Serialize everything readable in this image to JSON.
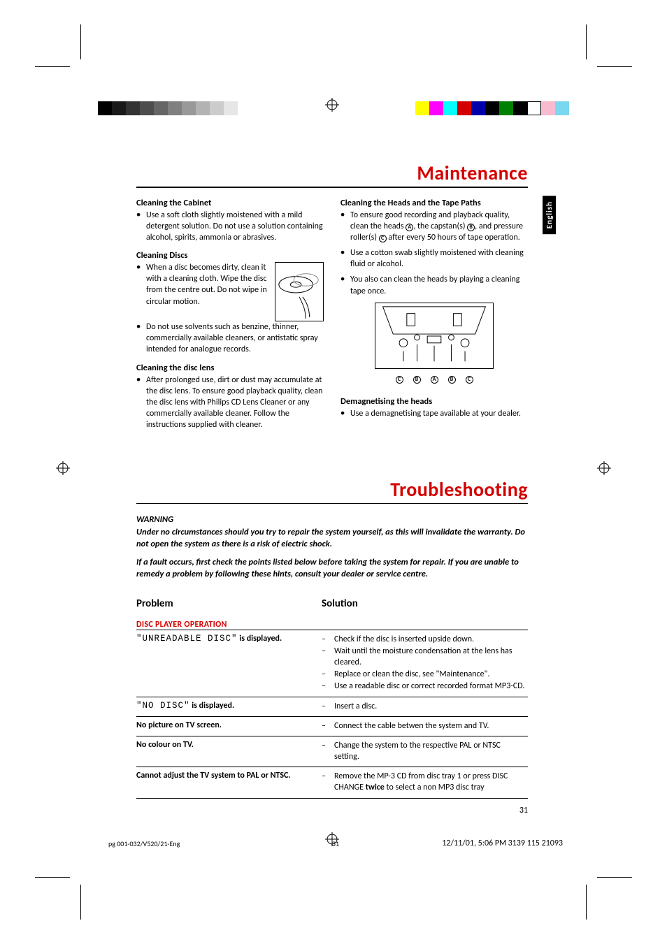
{
  "lang_tab": "English",
  "maintenance": {
    "title": "Maintenance",
    "left": {
      "cabinet_head": "Cleaning the Cabinet",
      "cabinet_text": "Use a soft cloth slightly moistened with a mild detergent solution. Do not use a solution containing alcohol, spirits, ammonia or abrasives.",
      "discs_head": "Cleaning Discs",
      "discs_b1": "When a disc becomes dirty, clean it with a cleaning cloth. Wipe the disc from the centre out.  Do not wipe in circular motion.",
      "discs_b2": "Do not use solvents such as benzine, thinner, commercially available cleaners, or antistatic spray intended for analogue records.",
      "lens_head": "Cleaning the disc lens",
      "lens_b1": "After prolonged use, dirt or dust may accumulate at the disc lens. To ensure good playback quality, clean the disc lens with Philips CD Lens Cleaner or any commercially available cleaner. Follow the instructions supplied with cleaner."
    },
    "right": {
      "heads_head": "Cleaning the Heads and the Tape Paths",
      "heads_b1_pre": "To ensure good recording and playback quality, clean the heads ",
      "heads_b1_a": "A",
      "heads_b1_mid1": ", the capstan(s) ",
      "heads_b1_b": "B",
      "heads_b1_mid2": ", and pressure roller(s) ",
      "heads_b1_c": "C",
      "heads_b1_post": " after every 50 hours of tape operation.",
      "heads_b2": "Use a cotton swab slightly moistened with cleaning fluid or alcohol.",
      "heads_b3": "You also can clean the heads by playing a cleaning tape once.",
      "diagram_labels": [
        "C",
        "B",
        "A",
        "B",
        "C"
      ],
      "demag_head": "Demagnetising the heads",
      "demag_b1": "Use a demagnetising tape available at your dealer."
    }
  },
  "troubleshooting": {
    "title": "Troubleshooting",
    "warning_label": "WARNING",
    "warning_1": "Under no circumstances should you try to repair the system yourself, as this will invalidate the warranty.  Do not open the system as there is a risk of electric shock.",
    "warning_2": "If a fault occurs, first check the points listed below before taking the system for repair. If you are unable to remedy a problem by following these hints, consult your dealer or service centre.",
    "col_problem": "Problem",
    "col_solution": "Solution",
    "section_disc": "DISC PLAYER OPERATION",
    "rows": [
      {
        "problem_lcd": "\"UNREADABLE DISC\"",
        "problem_suffix": " is displayed.",
        "solutions": [
          "Check if the disc is inserted upside down.",
          "Wait until the moisture condensation at the lens has cleared.",
          "Replace or clean the disc, see \"Maintenance\".",
          "Use a readable disc or correct recorded format MP3-CD."
        ]
      },
      {
        "problem_lcd": "\"NO DISC\"",
        "problem_suffix": " is displayed.",
        "solutions": [
          "Insert a disc."
        ]
      },
      {
        "problem_plain": "No picture on TV screen.",
        "solutions": [
          "Connect the cable betwen the system and TV."
        ]
      },
      {
        "problem_plain": "No colour on TV.",
        "solutions": [
          "Change the system to the respective PAL or NTSC setting."
        ]
      },
      {
        "problem_plain": "Cannot adjust the TV system to PAL or NTSC.",
        "solutions_html": "Remove the MP-3 CD from disc tray 1 or press DISC CHANGE <b>twice</b> to select a non MP3 disc tray"
      }
    ],
    "page_no": "31"
  },
  "footer": {
    "file": "pg 001-032/V520/21-Eng",
    "page": "31",
    "date": "12/11/01, 5:06 PM",
    "part": "3139 115 21093"
  },
  "print_marks": {
    "gray_shades": [
      "#000",
      "#1a1a1a",
      "#333",
      "#4d4d4d",
      "#666",
      "#808080",
      "#999",
      "#b3b3b3",
      "#ccc",
      "#e6e6e6",
      "#fff"
    ],
    "colors": [
      "#ff0",
      "#f0f",
      "#0ff",
      "#d40000",
      "#00a",
      "#000",
      "#008000",
      "#000",
      "#fff",
      "#f7bacf",
      "#7ad7f0"
    ]
  }
}
